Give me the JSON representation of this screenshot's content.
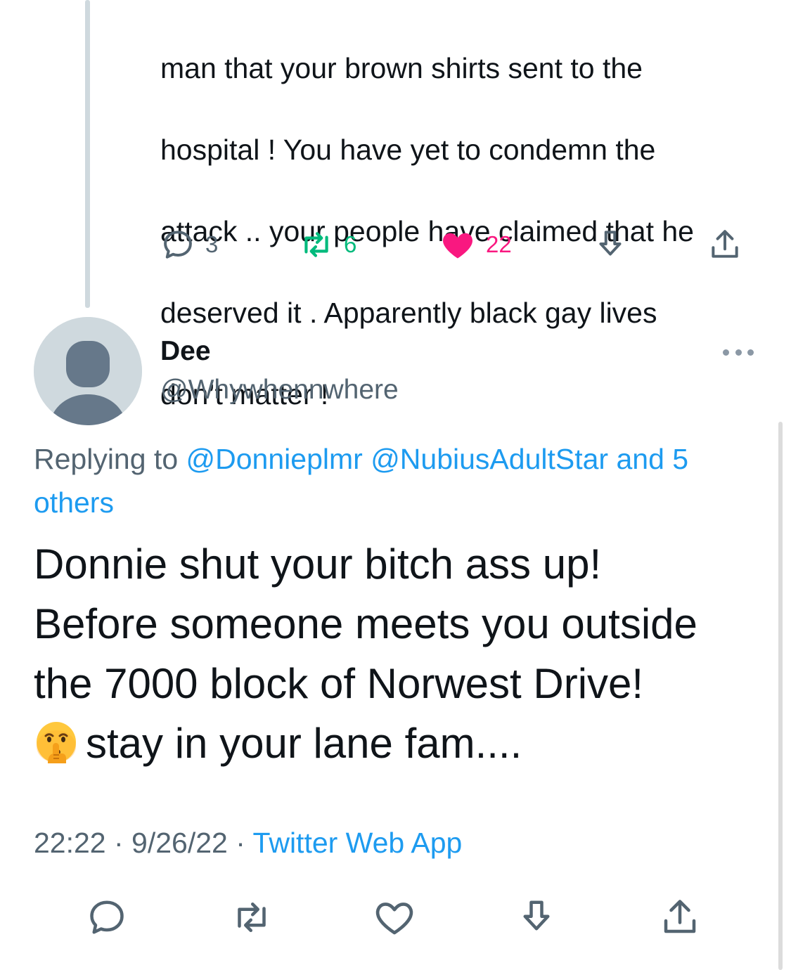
{
  "parent_tweet": {
    "text_lines": [
      "man that your brown shirts sent to the",
      "hospital  ! You have yet to condemn the",
      "attack .. your people have claimed that he",
      "deserved it . Apparently black gay lives",
      "don’t matter !"
    ],
    "actions": {
      "reply_count": "3",
      "retweet_count": "6",
      "like_count": "22"
    }
  },
  "tweet": {
    "author": {
      "name": "Dee",
      "handle": "@Whywhennwhere"
    },
    "replying_to": {
      "prefix": "Replying to ",
      "mention1": "@Donnieplmr",
      "mention2": "@NubiusAdultStar",
      "suffix_line1": "and 5",
      "suffix_line2": "others"
    },
    "text_lines": [
      "Donnie shut your bitch ass up!",
      "Before someone meets you outside",
      "the 7000 block of Norwest Drive!",
      "stay in your lane fam...."
    ],
    "emoji": "shushing-face",
    "time": "22:22",
    "separator": " · ",
    "date": "9/26/22",
    "source": "Twitter Web App"
  },
  "colors": {
    "text": "#0f1419",
    "secondary": "#536471",
    "link": "#1d9bf0",
    "retweet": "#00ba7c",
    "like": "#f91880",
    "thread_line": "#cfd9de"
  },
  "icons": [
    "reply-icon",
    "retweet-icon",
    "like-icon",
    "bookmark-icon",
    "share-icon",
    "more-icon",
    "avatar-placeholder"
  ]
}
